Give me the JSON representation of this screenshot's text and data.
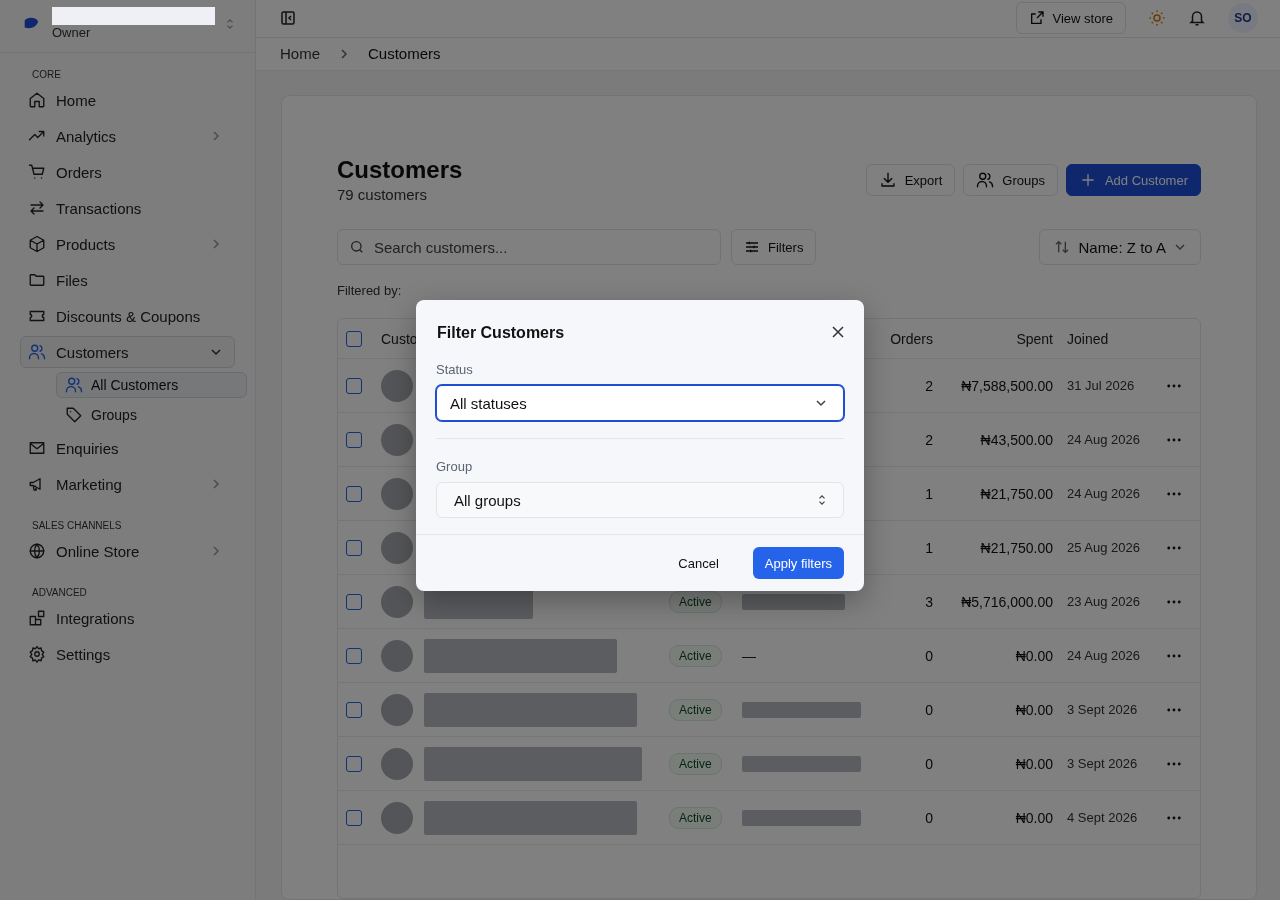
{
  "sidebar": {
    "store_role": "Owner",
    "sections": [
      {
        "label": "CORE",
        "items": [
          {
            "label": "Home",
            "has_submenu": false,
            "selected": false
          },
          {
            "label": "Analytics",
            "has_submenu": true,
            "selected": false
          },
          {
            "label": "Orders",
            "has_submenu": false,
            "selected": false
          },
          {
            "label": "Transactions",
            "has_submenu": false,
            "selected": false
          },
          {
            "label": "Products",
            "has_submenu": true,
            "selected": false
          },
          {
            "label": "Files",
            "has_submenu": false,
            "selected": false
          },
          {
            "label": "Discounts & Coupons",
            "has_submenu": false,
            "selected": false
          },
          {
            "label": "Customers",
            "has_submenu": true,
            "selected": true,
            "expanded": true,
            "children": [
              {
                "label": "All Customers",
                "selected": true
              },
              {
                "label": "Groups",
                "selected": false
              }
            ]
          },
          {
            "label": "Enquiries",
            "has_submenu": false,
            "selected": false
          },
          {
            "label": "Marketing",
            "has_submenu": true,
            "selected": false
          }
        ]
      },
      {
        "label": "SALES CHANNELS",
        "items": [
          {
            "label": "Online Store",
            "has_submenu": true,
            "selected": false
          }
        ]
      },
      {
        "label": "ADVANCED",
        "items": [
          {
            "label": "Integrations",
            "has_submenu": false,
            "selected": false
          },
          {
            "label": "Settings",
            "has_submenu": false,
            "selected": false
          }
        ]
      }
    ]
  },
  "topbar": {
    "view_store": "View store",
    "avatar": "SO"
  },
  "breadcrumb": [
    "Home",
    "Customers"
  ],
  "page": {
    "title": "Customers",
    "subtitle": "79 customers",
    "actions": [
      {
        "label": "Export",
        "kind": "export"
      },
      {
        "label": "Groups",
        "kind": "groups"
      },
      {
        "label": "Add Customer",
        "kind": "add"
      }
    ],
    "search": {
      "placeholder": "Search customers..."
    },
    "filters_button": "Filters",
    "sort": "Name: Z to A",
    "filtered_by": "Filtered by:"
  },
  "table": {
    "header_checked": false,
    "columns": [
      "Custo",
      "Orders",
      "Spent",
      "Joined"
    ],
    "rows": [
      {
        "checked": false,
        "orders": "2",
        "spent": "₦7,588,500.00",
        "joined": "31 Jul 2026"
      },
      {
        "checked": false,
        "orders": "2",
        "spent": "₦43,500.00",
        "joined": "24 Aug 2026"
      },
      {
        "checked": false,
        "orders": "1",
        "spent": "₦21,750.00",
        "joined": "24 Aug 2026"
      },
      {
        "checked": false,
        "orders": "1",
        "spent": "₦21,750.00",
        "joined": "25 Aug 2026"
      },
      {
        "checked": false,
        "status": "Active",
        "orders": "3",
        "spent": "₦5,716,000.00",
        "joined": "23 Aug 2026"
      },
      {
        "checked": false,
        "status": "Active",
        "group": "—",
        "orders": "0",
        "spent": "₦0.00",
        "joined": "24 Aug 2026"
      },
      {
        "checked": false,
        "status": "Active",
        "orders": "0",
        "spent": "₦0.00",
        "joined": "3 Sept 2026"
      },
      {
        "checked": false,
        "status": "Active",
        "orders": "0",
        "spent": "₦0.00",
        "joined": "3 Sept 2026"
      },
      {
        "checked": false,
        "status": "Active",
        "orders": "0",
        "spent": "₦0.00",
        "joined": "4 Sept 2026"
      }
    ]
  },
  "modal": {
    "title": "Filter Customers",
    "status": {
      "label": "Status",
      "value": "All statuses",
      "focused": true
    },
    "group": {
      "label": "Group",
      "value": "All groups",
      "focused": false
    },
    "cancel": "Cancel",
    "apply": "Apply filters"
  }
}
